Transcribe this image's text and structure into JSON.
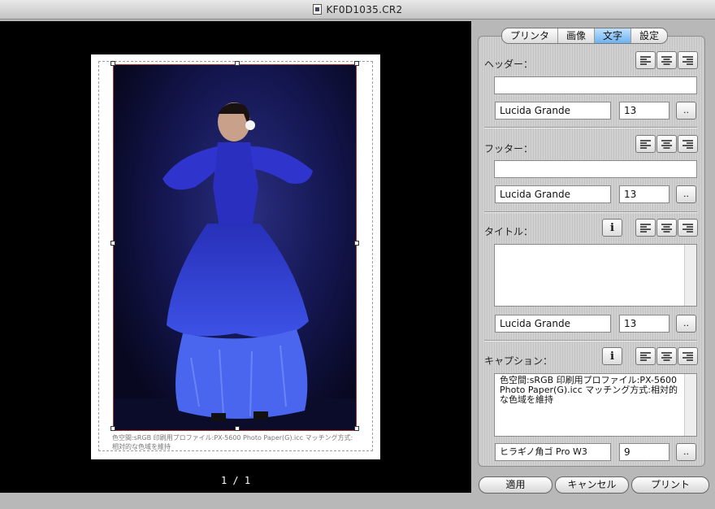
{
  "window": {
    "title": "KF0D1035.CR2"
  },
  "preview": {
    "caption": "色空間:sRGB 印刷用プロファイル:PX-5600 Photo Paper(G).icc マッチング方式:相対的な色域を維持",
    "page": "1 / 1"
  },
  "tabs": [
    {
      "label": "プリンタ",
      "selected": false
    },
    {
      "label": "画像",
      "selected": false
    },
    {
      "label": "文字",
      "selected": true
    },
    {
      "label": "設定",
      "selected": false
    }
  ],
  "header": {
    "label": "ヘッダー：",
    "text": "",
    "font": "Lucida Grande",
    "size": "13"
  },
  "footer": {
    "label": "フッター：",
    "text": "",
    "font": "Lucida Grande",
    "size": "13"
  },
  "title_section": {
    "label": "タイトル：",
    "info": "i",
    "text": "",
    "font": "Lucida Grande",
    "size": "13"
  },
  "caption_section": {
    "label": "キャプション：",
    "info": "i",
    "text": "色空間:sRGB 印刷用プロファイル:PX-5600 Photo Paper(G).icc マッチング方式:相対的な色域を維持",
    "font": "ヒラギノ角ゴ Pro W3",
    "size": "9"
  },
  "more_label": "..",
  "buttons": {
    "apply": "適用",
    "cancel": "キャンセル",
    "print": "プリント"
  }
}
